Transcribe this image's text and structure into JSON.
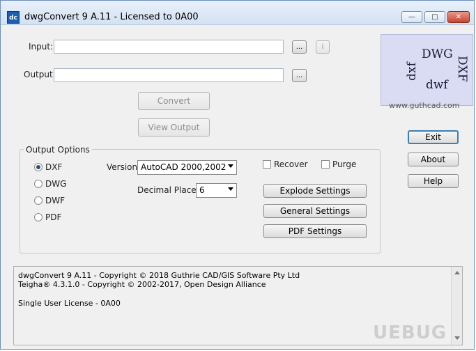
{
  "window": {
    "title": "dwgConvert 9 A.11 - Licensed to 0A00",
    "icon_text": "dc",
    "controls": {
      "minimize": "—",
      "maximize": "□",
      "close": "✕"
    }
  },
  "io": {
    "input_label": "Input:",
    "input_value": "",
    "output_label": "Output:",
    "output_value": "",
    "browse_label": "...",
    "info_label": "i"
  },
  "actions": {
    "convert": "Convert",
    "view_output": "View Output",
    "exit": "Exit",
    "about": "About",
    "help": "Help"
  },
  "logo": {
    "dwg": "DWG",
    "dxf_side": "DXF",
    "dxf_rotated": "dxf",
    "dwf": "dwf",
    "url": "www.guthcad.com"
  },
  "output_options": {
    "title": "Output Options",
    "formats": [
      {
        "label": "DXF",
        "selected": true
      },
      {
        "label": "DWG",
        "selected": false
      },
      {
        "label": "DWF",
        "selected": false
      },
      {
        "label": "PDF",
        "selected": false
      }
    ],
    "version_label": "Version:",
    "version_value": "AutoCAD 2000,2002",
    "decimal_label": "Decimal Places:",
    "decimal_value": "6",
    "recover_label": "Recover",
    "purge_label": "Purge",
    "explode_settings": "Explode Settings",
    "general_settings": "General Settings",
    "pdf_settings": "PDF Settings"
  },
  "log": {
    "line1": "dwgConvert 9 A.11 - Copyright © 2018 Guthrie CAD/GIS Software Pty Ltd",
    "line2": "Teigha® 4.3.1.0 - Copyright © 2002-2017, Open Design Alliance",
    "line3": "Single User License - 0A00"
  },
  "watermark": "UEBUG"
}
